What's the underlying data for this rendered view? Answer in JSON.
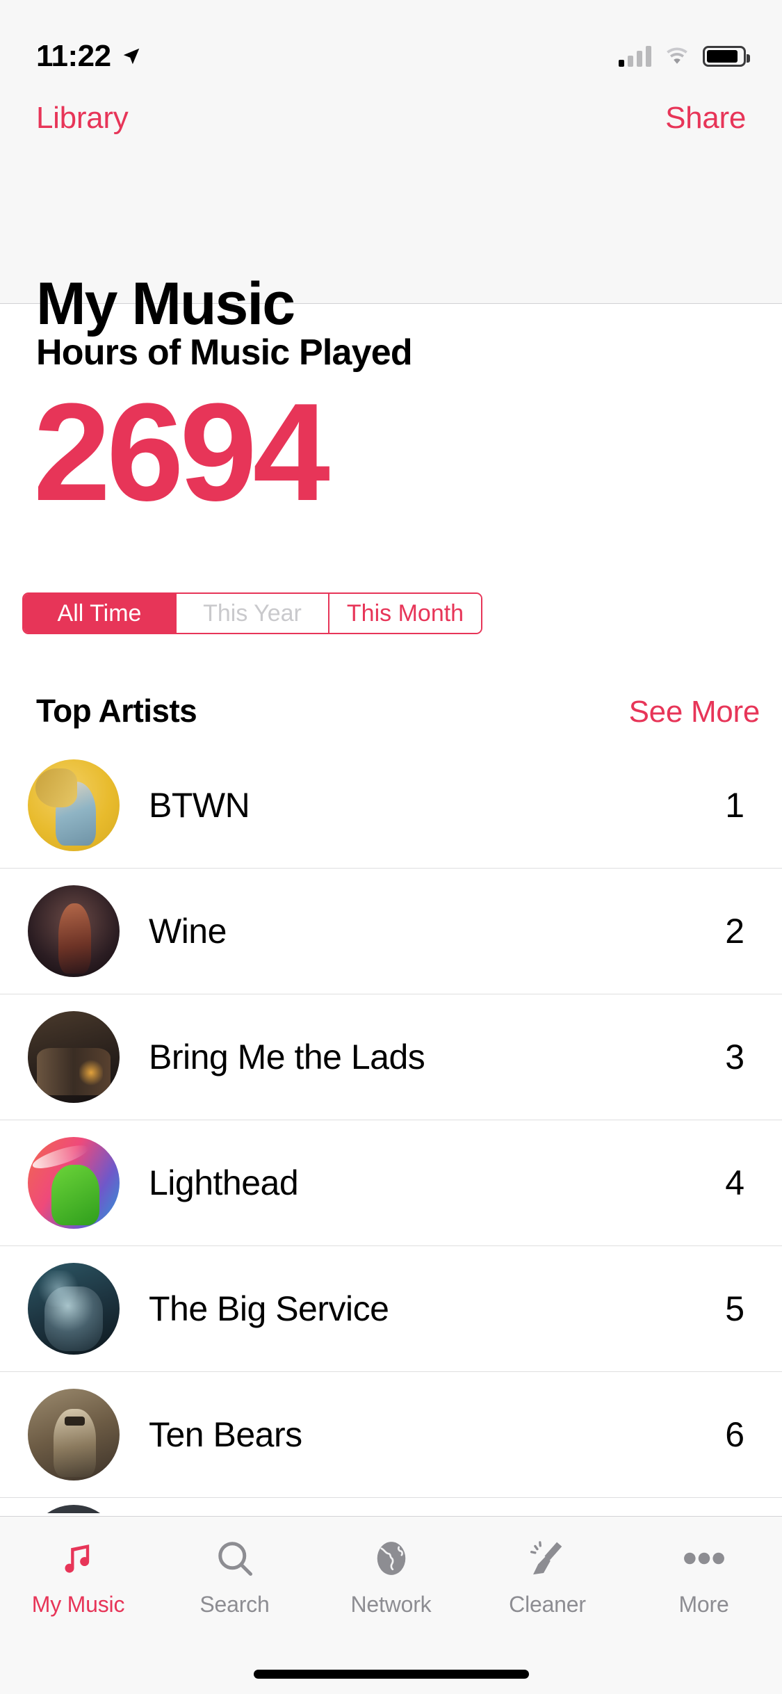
{
  "status_bar": {
    "time": "11:22",
    "location_icon": "location-arrow-icon",
    "cellular_icon": "cellular-bars-icon",
    "wifi_icon": "wifi-icon",
    "battery_icon": "battery-icon"
  },
  "nav": {
    "back_label": "Library",
    "action_label": "Share",
    "title": "My Music"
  },
  "stats": {
    "label": "Hours of Music Played",
    "value": "2694",
    "accent_color": "#e73558"
  },
  "segmented": {
    "options": [
      {
        "label": "All Time",
        "state": "active"
      },
      {
        "label": "This Year",
        "state": "disabled"
      },
      {
        "label": "This Month",
        "state": "normal"
      }
    ]
  },
  "top_artists": {
    "title": "Top Artists",
    "see_more": "See More",
    "rows": [
      {
        "name": "BTWN",
        "rank": "1",
        "avatar": "artist-avatar-btwn"
      },
      {
        "name": "Wine",
        "rank": "2",
        "avatar": "artist-avatar-wine"
      },
      {
        "name": "Bring Me the Lads",
        "rank": "3",
        "avatar": "artist-avatar-bring-me-the-lads"
      },
      {
        "name": "Lighthead",
        "rank": "4",
        "avatar": "artist-avatar-lighthead"
      },
      {
        "name": "The Big Service",
        "rank": "5",
        "avatar": "artist-avatar-the-big-service"
      },
      {
        "name": "Ten Bears",
        "rank": "6",
        "avatar": "artist-avatar-ten-bears"
      },
      {
        "name": "",
        "rank": "",
        "avatar": "artist-avatar-partial"
      }
    ]
  },
  "tabbar": {
    "items": [
      {
        "label": "My Music",
        "icon": "music-note-icon",
        "active": true
      },
      {
        "label": "Search",
        "icon": "search-icon",
        "active": false
      },
      {
        "label": "Network",
        "icon": "globe-icon",
        "active": false
      },
      {
        "label": "Cleaner",
        "icon": "broom-icon",
        "active": false
      },
      {
        "label": "More",
        "icon": "ellipsis-icon",
        "active": false
      }
    ]
  }
}
